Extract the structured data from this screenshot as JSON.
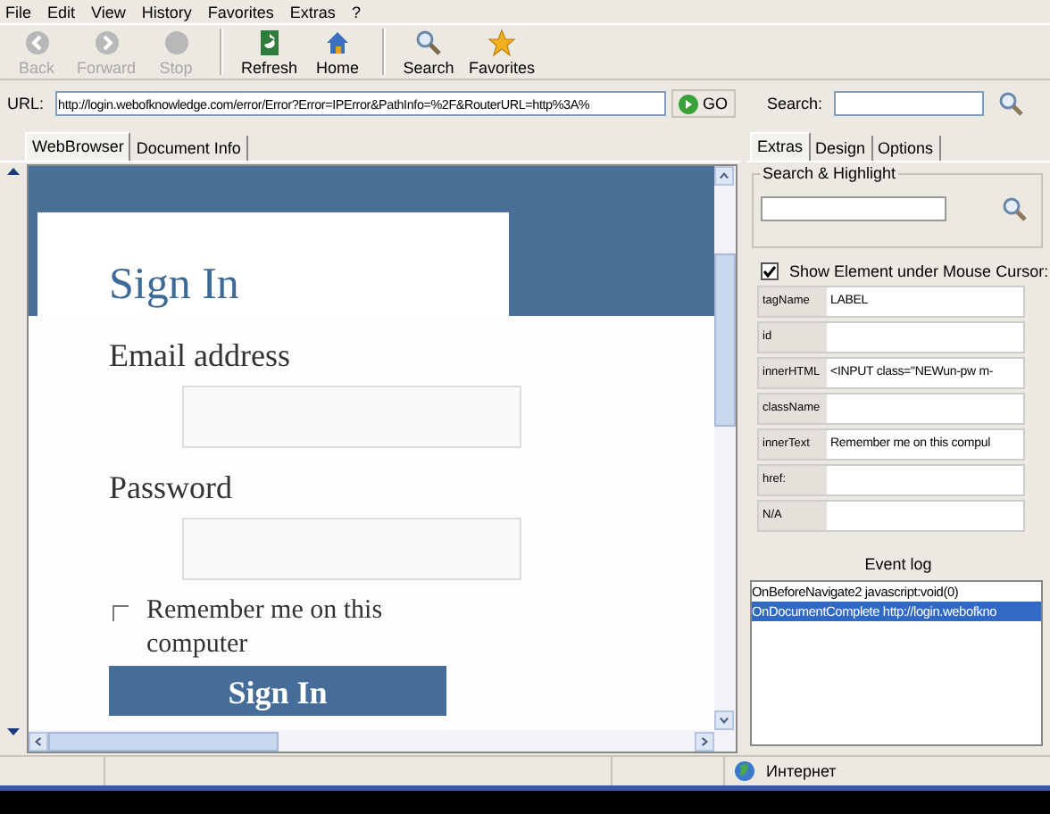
{
  "menu": [
    "File",
    "Edit",
    "View",
    "History",
    "Favorites",
    "Extras",
    "?"
  ],
  "toolbar": [
    {
      "label": "Back",
      "kind": "back",
      "disabled": true
    },
    {
      "label": "Forward",
      "kind": "forward",
      "disabled": true
    },
    {
      "label": "Stop",
      "kind": "stop",
      "disabled": true
    },
    {
      "label": "Refresh",
      "kind": "refresh",
      "disabled": false
    },
    {
      "label": "Home",
      "kind": "home",
      "disabled": false
    },
    {
      "label": "Search",
      "kind": "search",
      "disabled": false
    },
    {
      "label": "Favorites",
      "kind": "favorites",
      "disabled": false
    }
  ],
  "address": {
    "label": "URL:",
    "value": "http://login.webofknowledge.com/error/Error?Error=IPError&PathInfo=%2F&RouterURL=http%3A%",
    "go": "GO",
    "search_label": "Search:"
  },
  "left_tabs": [
    {
      "label": "WebBrowser",
      "selected": true
    },
    {
      "label": "Document Info",
      "selected": false
    }
  ],
  "page": {
    "heading": "Sign In",
    "email_label": "Email address",
    "password_label": "Password",
    "remember": {
      "label": "Remember me on this computer",
      "checked": false
    },
    "button": "Sign In"
  },
  "right_tabs": [
    {
      "label": "Extras",
      "selected": true
    },
    {
      "label": "Design",
      "selected": false
    },
    {
      "label": "Options",
      "selected": false
    }
  ],
  "search_highlight": {
    "title": "Search & Highlight"
  },
  "show_element": {
    "label": "Show Element under Mouse Cursor:",
    "checked": true
  },
  "properties": [
    {
      "name": "tagName",
      "value": "LABEL"
    },
    {
      "name": "id"
    },
    {
      "name": "innerHTML",
      "value": "<INPUT class=\"NEWun-pw m-"
    },
    {
      "name": "className"
    },
    {
      "name": "innerText",
      "value": "Remember me on this compul"
    },
    {
      "name": "href:"
    },
    {
      "name": "N/A"
    }
  ],
  "event_log": {
    "title": "Event log",
    "entries": [
      {
        "text": "OnBeforeNavigate2 javascript:void(0)",
        "selected": false
      },
      {
        "text": "OnDocumentComplete http://login.webofkno",
        "selected": true
      }
    ]
  },
  "status_bar": {
    "zone": "Интернет"
  }
}
